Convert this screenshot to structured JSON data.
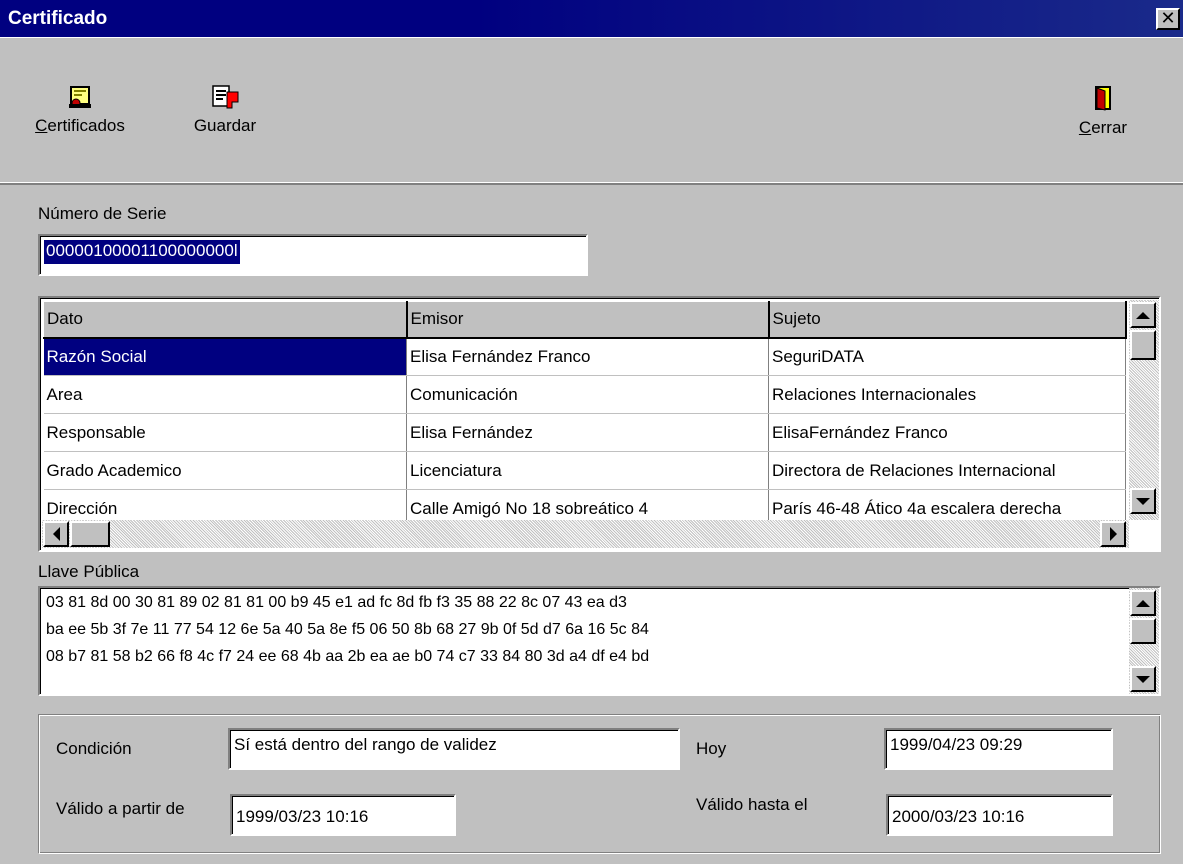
{
  "window": {
    "title": "Certificado",
    "close_glyph": "✕"
  },
  "toolbar": {
    "certificados": {
      "accel": "C",
      "rest": "ertificados",
      "icon": "certificate-icon"
    },
    "guardar": {
      "label": "Guardar",
      "icon": "save-icon"
    },
    "cerrar": {
      "accel": "C",
      "rest": "errar",
      "icon": "exit-door-icon"
    }
  },
  "serial": {
    "label": "Número de Serie",
    "value": "00000100001100000000l"
  },
  "grid": {
    "columns": [
      "Dato",
      "Emisor",
      "Sujeto"
    ],
    "rows": [
      [
        "Razón Social",
        "Elisa Fernández Franco",
        "SeguriDATA"
      ],
      [
        "Area",
        "Comunicación",
        "Relaciones Internacionales"
      ],
      [
        "Responsable",
        "Elisa Fernández",
        "ElisaFernández Franco"
      ],
      [
        "Grado Academico",
        "Licenciatura",
        "Directora de Relaciones Internacional"
      ],
      [
        "Dirección",
        "Calle Amigó No 18 sobreático 4",
        "París 46-48 Ático 4a escalera derecha"
      ]
    ]
  },
  "public_key": {
    "label": "Llave Pública",
    "lines": [
      "03 81 8d 00 30 81 89 02 81 81 00 b9 45 e1 ad fc 8d fb f3 35 88 22 8c 07 43 ea d3",
      "ba ee 5b 3f 7e 11 77 54 12 6e 5a 40 5a 8e f5 06 50 8b 68 27 9b 0f 5d d7 6a 16 5c 84",
      "08 b7 81 58 b2 66 f8 4c f7 24 ee 68 4b aa 2b ea ae b0 74 c7 33 84 80 3d a4 df e4 bd"
    ]
  },
  "validity": {
    "condicion_label": "Condición",
    "condicion_value": "Sí está dentro del rango de validez",
    "hoy_label": "Hoy",
    "hoy_value": "1999/04/23  09:29",
    "desde_label": "Válido a partir de",
    "desde_value": "1999/03/23  10:16",
    "hasta_label": "Válido hasta el",
    "hasta_value": "2000/03/23  10:16"
  },
  "colors": {
    "titlebar": "#000080",
    "face": "#c0c0c0",
    "selection": "#000080"
  }
}
